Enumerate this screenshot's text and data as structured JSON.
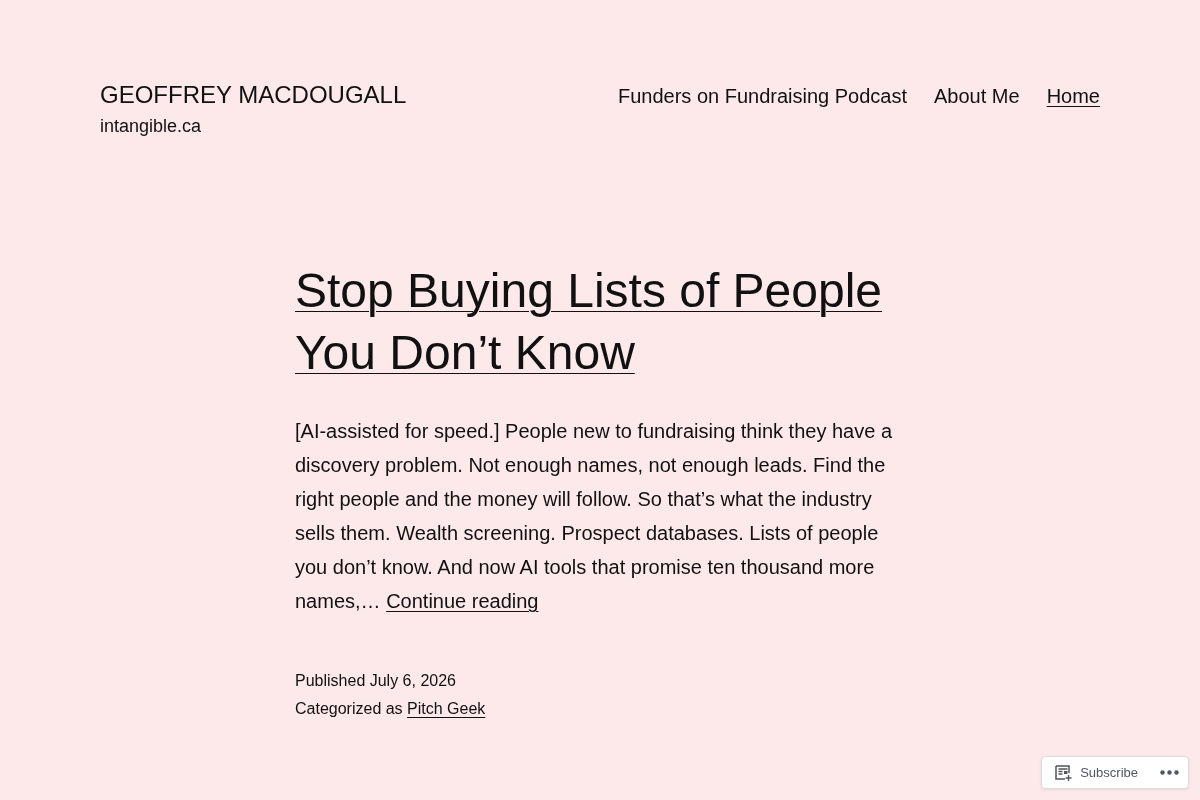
{
  "site": {
    "title": "GEOFFREY MACDOUGALL",
    "tagline": "intangible.ca"
  },
  "nav": {
    "items": [
      {
        "label": "Funders on Fundraising Podcast",
        "selected": false
      },
      {
        "label": "About Me",
        "selected": false
      },
      {
        "label": "Home",
        "selected": true
      }
    ]
  },
  "post": {
    "title": "Stop Buying Lists of People You Don’t Know",
    "excerpt": "[AI-assisted for speed.] People new to fundraising think they have a discovery problem. Not enough names, not enough leads. Find the right people and the money will follow. So that’s what the industry sells them. Wealth screening. Prospect databases. Lists of people you don’t know. And now AI tools that promise ten thousand more names,…",
    "more_link": "Continue reading",
    "published": "Published July 6, 2026",
    "category_label": "Categorized as",
    "category": "Pitch Geek"
  },
  "subscribe_bar": {
    "label": "Subscribe"
  }
}
